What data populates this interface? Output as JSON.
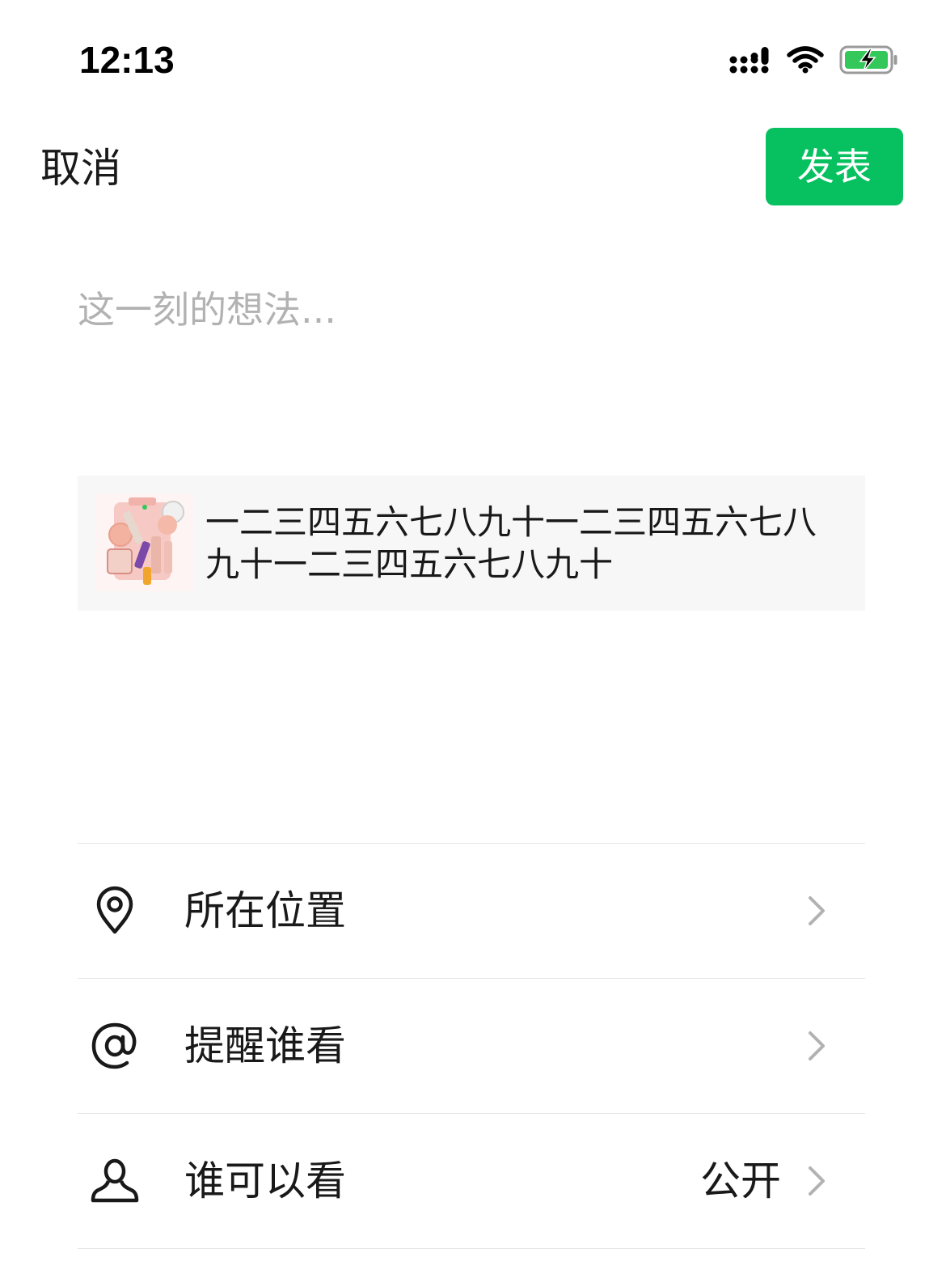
{
  "status_bar": {
    "time": "12:13",
    "icons": [
      "cellular-signal-icon",
      "wifi-icon",
      "battery-charging-icon"
    ]
  },
  "nav": {
    "cancel_label": "取消",
    "publish_label": "发表"
  },
  "composer": {
    "placeholder": "这一刻的想法...",
    "value": ""
  },
  "link_card": {
    "thumbnail": "cosmetics-product-image",
    "title": "一二三四五六七八九十一二三四五六七八九十一二三四五六七八九十"
  },
  "options": [
    {
      "icon": "location-pin-icon",
      "label": "所在位置",
      "value": ""
    },
    {
      "icon": "at-sign-icon",
      "label": "提醒谁看",
      "value": ""
    },
    {
      "icon": "person-icon",
      "label": "谁可以看",
      "value": "公开"
    }
  ],
  "colors": {
    "primary_green": "#07c160",
    "placeholder_gray": "#b2b2b2",
    "card_background": "#f7f7f7",
    "divider": "#e5e5e5"
  }
}
